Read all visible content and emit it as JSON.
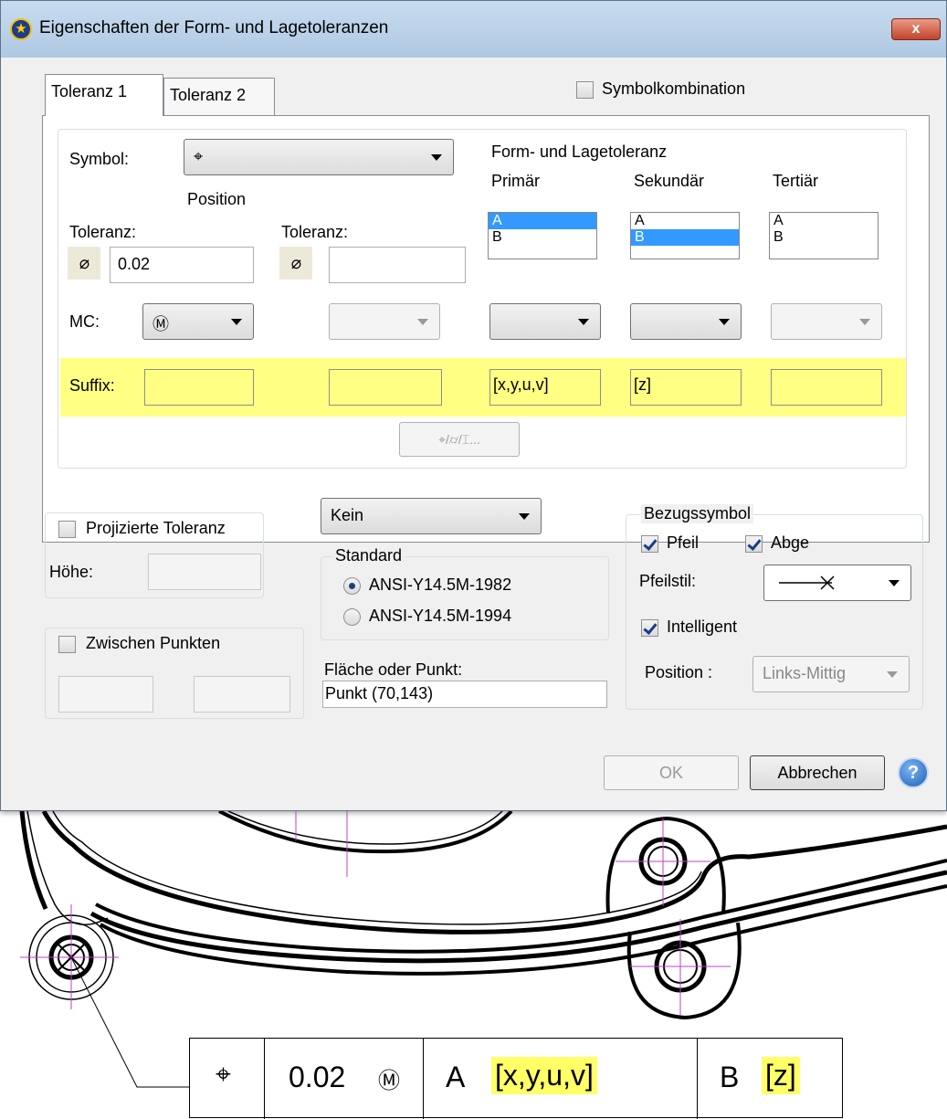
{
  "dialog": {
    "title": "Eigenschaften der Form- und Lagetoleranzen",
    "close_label": "x",
    "tabs": [
      "Toleranz 1",
      "Toleranz 2"
    ],
    "symbol_combination_label": "Symbolkombination",
    "symbol_label": "Symbol:",
    "symbol_value": "⌖",
    "symbol_name": "Position",
    "tolerance1_label": "Toleranz:",
    "tolerance1_prefix": "⌀",
    "tolerance1_value": "0.02",
    "tolerance2_label": "Toleranz:",
    "tolerance2_prefix": "⌀",
    "tolerance2_value": "",
    "datum_group_label": "Form- und Lagetoleranz",
    "datum_columns": [
      {
        "header": "Primär",
        "items": [
          "A",
          "B"
        ],
        "selected": "A"
      },
      {
        "header": "Sekundär",
        "items": [
          "A",
          "B"
        ],
        "selected": "B"
      },
      {
        "header": "Tertiär",
        "items": [
          "A",
          "B"
        ],
        "selected": ""
      }
    ],
    "mc_label": "MC:",
    "mc_value": "Ⓜ",
    "suffix_label": "Suffix:",
    "suffix_values": [
      "",
      "",
      "[x,y,u,v]",
      "[z]",
      ""
    ],
    "symbols_button_label": "⌖/⌭/⌶...",
    "projected_tolerance_label": "Projizierte Toleranz",
    "height_label": "Höhe:",
    "between_points_label": "Zwischen Punkten",
    "modifier_combo_value": "Kein",
    "standard_group_label": "Standard",
    "standard_options": [
      "ANSI-Y14.5M-1982",
      "ANSI-Y14.5M-1994"
    ],
    "standard_selected": "ANSI-Y14.5M-1982",
    "surface_point_label": "Fläche oder Punkt:",
    "surface_point_value": "Punkt (70,143)",
    "reference_group_label": "Bezugssymbol",
    "arrow_label": "Pfeil",
    "abge_label": "Abge",
    "arrow_style_label": "Pfeilstil:",
    "intelligent_label": "Intelligent",
    "position_label": "Position :",
    "position_value": "Links-Mittig",
    "ok_label": "OK",
    "cancel_label": "Abbrechen",
    "help_label": "?"
  },
  "frame": {
    "symbol": "⌖",
    "tolerance": "0.02",
    "modifier": "Ⓜ",
    "primary_datum": "A",
    "primary_suffix": "[x,y,u,v]",
    "secondary_datum": "B",
    "secondary_suffix": "[z]"
  },
  "colors": {
    "suffix_highlight": "#ffff84",
    "selection": "#3399ff",
    "titlebar": "#b9d1ea",
    "centerline": "#c040c0"
  }
}
